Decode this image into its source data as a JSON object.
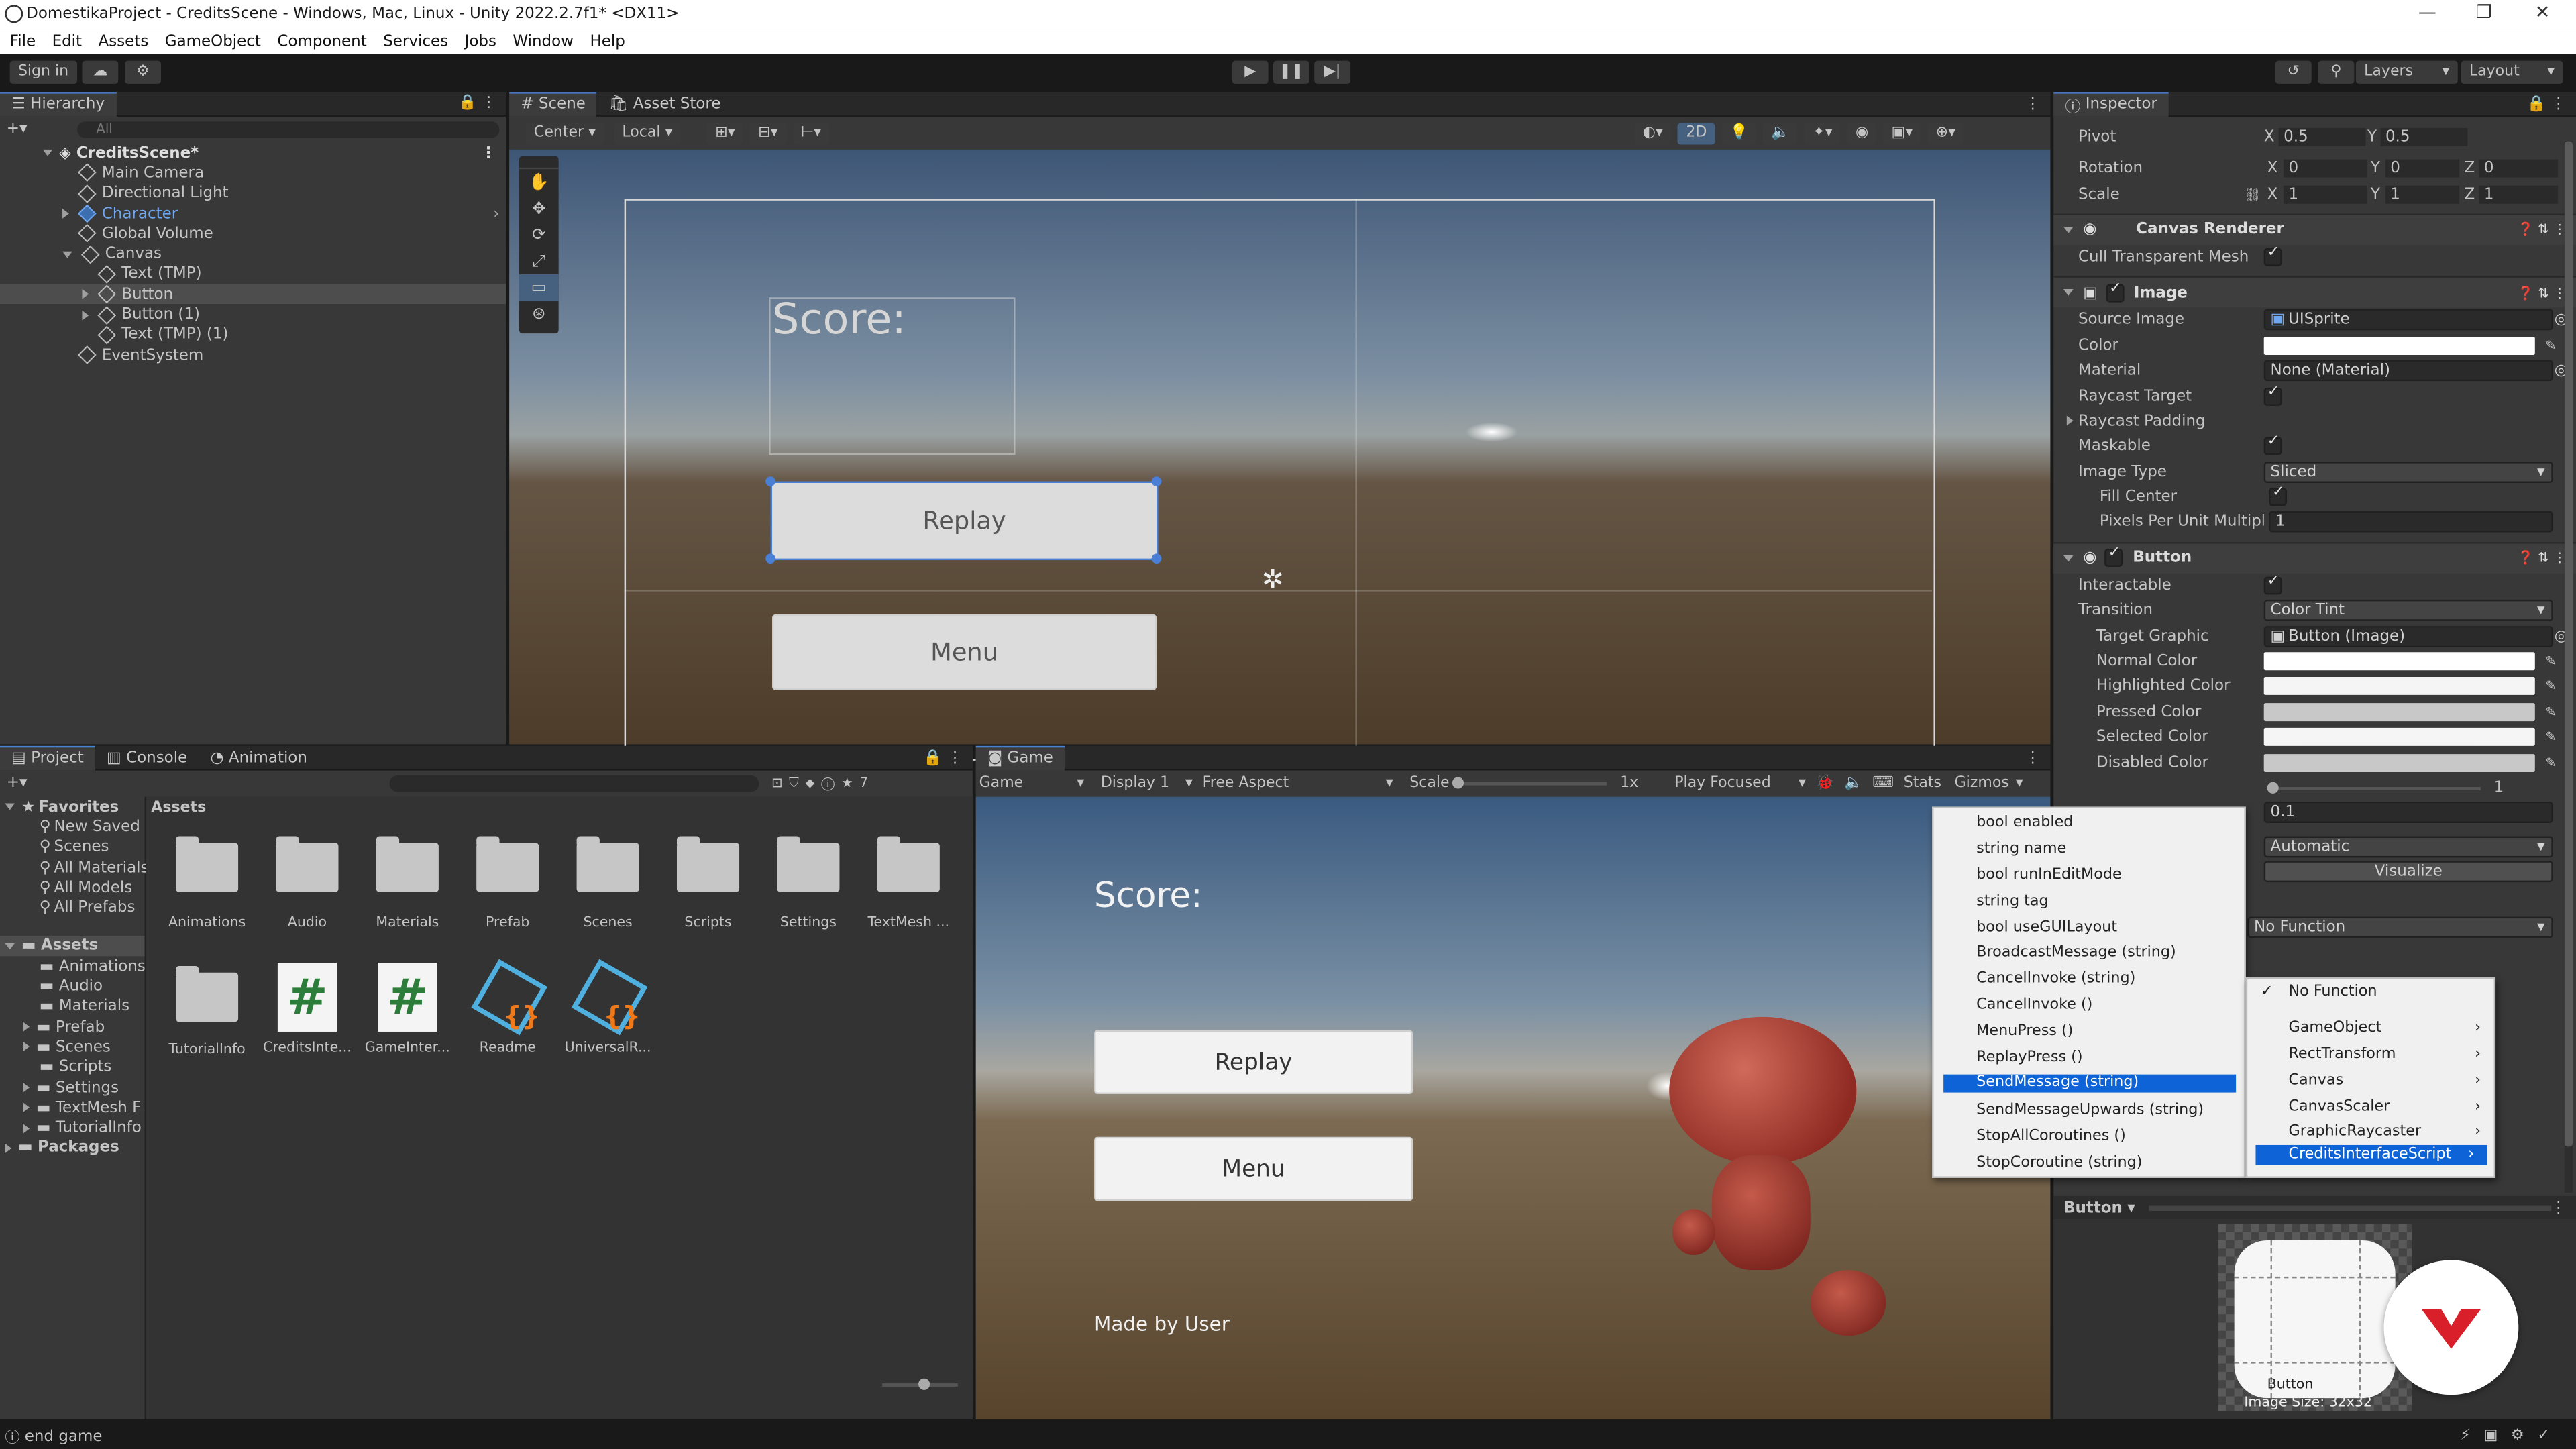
{
  "window": {
    "title": "DomestikaProject - CreditsScene - Windows, Mac, Linux - Unity 2022.2.7f1* <DX11>"
  },
  "menubar": [
    "File",
    "Edit",
    "Assets",
    "GameObject",
    "Component",
    "Services",
    "Jobs",
    "Window",
    "Help"
  ],
  "toolbar": {
    "sign_in": "Sign in",
    "layers": "Layers",
    "layout": "Layout"
  },
  "hierarchy": {
    "tab": "Hierarchy",
    "search_placeholder": "All",
    "items": [
      {
        "label": "CreditsScene*",
        "depth": 0
      },
      {
        "label": "Main Camera",
        "depth": 1
      },
      {
        "label": "Directional Light",
        "depth": 1
      },
      {
        "label": "Character",
        "depth": 1
      },
      {
        "label": "Global Volume",
        "depth": 1
      },
      {
        "label": "Canvas",
        "depth": 1
      },
      {
        "label": "Text (TMP)",
        "depth": 2
      },
      {
        "label": "Button",
        "depth": 2
      },
      {
        "label": "Button (1)",
        "depth": 2
      },
      {
        "label": "Text (TMP) (1)",
        "depth": 2
      },
      {
        "label": "EventSystem",
        "depth": 1
      }
    ]
  },
  "scene": {
    "tabs": [
      "Scene",
      "Asset Store"
    ],
    "pivot": "Center",
    "space": "Local",
    "mode_2d": "2D",
    "score_label": "Score:",
    "replay_label": "Replay",
    "menu_label": "Menu"
  },
  "project": {
    "tabs": [
      "Project",
      "Console",
      "Animation"
    ],
    "hidden_count": "7",
    "favorites_label": "Favorites",
    "favorites": [
      "New Saved",
      "Scenes",
      "All Materials",
      "All Models",
      "All Prefabs"
    ],
    "assets_label": "Assets",
    "assets_tree": [
      "Animations",
      "Audio",
      "Materials",
      "Prefab",
      "Scenes",
      "Scripts",
      "Settings",
      "TextMesh F",
      "TutorialInfo"
    ],
    "packages_label": "Packages",
    "breadcrumb": "Assets",
    "grid": [
      {
        "label": "Animations",
        "kind": "folder"
      },
      {
        "label": "Audio",
        "kind": "folder"
      },
      {
        "label": "Materials",
        "kind": "folder"
      },
      {
        "label": "Prefab",
        "kind": "folder"
      },
      {
        "label": "Scenes",
        "kind": "folder"
      },
      {
        "label": "Scripts",
        "kind": "folder"
      },
      {
        "label": "Settings",
        "kind": "folder"
      },
      {
        "label": "TextMesh ...",
        "kind": "folder"
      },
      {
        "label": "TutorialInfo",
        "kind": "folder"
      },
      {
        "label": "CreditsInte...",
        "kind": "script"
      },
      {
        "label": "GameInter...",
        "kind": "script"
      },
      {
        "label": "Readme",
        "kind": "asset"
      },
      {
        "label": "UniversalR...",
        "kind": "asset"
      }
    ]
  },
  "game": {
    "tab": "Game",
    "view": "Game",
    "display": "Display 1",
    "aspect": "Free Aspect",
    "scale_label": "Scale",
    "scale_value": "1x",
    "play_mode": "Play Focused",
    "stats": "Stats",
    "gizmos": "Gizmos",
    "score_label": "Score:",
    "replay_label": "Replay",
    "menu_label": "Menu",
    "credit": "Made by User"
  },
  "inspector": {
    "tab": "Inspector",
    "pivot": {
      "label": "Pivot",
      "x": "0.5",
      "y": "0.5"
    },
    "rotation": {
      "label": "Rotation",
      "x": "0",
      "y": "0",
      "z": "0"
    },
    "scale": {
      "label": "Scale",
      "x": "1",
      "y": "1",
      "z": "1"
    },
    "canvas_renderer": {
      "title": "Canvas Renderer",
      "cull": "Cull Transparent Mesh"
    },
    "image": {
      "title": "Image",
      "source_image_label": "Source Image",
      "source_image": "UISprite",
      "color_label": "Color",
      "material_label": "Material",
      "material": "None (Material)",
      "raycast_target": "Raycast Target",
      "raycast_padding": "Raycast Padding",
      "maskable": "Maskable",
      "image_type_label": "Image Type",
      "image_type": "Sliced",
      "fill_center": "Fill Center",
      "ppu_label": "Pixels Per Unit Multiplie",
      "ppu": "1"
    },
    "button": {
      "title": "Button",
      "interactable": "Interactable",
      "transition_label": "Transition",
      "transition": "Color Tint",
      "target_graphic_label": "Target Graphic",
      "target_graphic": "Button (Image)",
      "normal": "Normal Color",
      "highlighted": "Highlighted Color",
      "pressed": "Pressed Color",
      "selected": "Selected Color",
      "disabled": "Disabled Color",
      "color_multiplier": "1",
      "fade_duration": "0.1",
      "navigation": "Automatic",
      "visualize": "Visualize",
      "function_field": "No Function"
    },
    "preview_label": "Button",
    "preview_name": "Button",
    "preview_size": "Image Size: 32x32"
  },
  "colors": {
    "accent": "#0e63d6",
    "normal": "#ffffff",
    "highlighted": "#f5f5f5",
    "pressed": "#c8c8c8",
    "selected": "#f5f5f5",
    "disabled": "#c8c8c8"
  },
  "dropdown_methods": [
    "bool enabled",
    "string name",
    "bool runInEditMode",
    "string tag",
    "bool useGUILayout",
    "BroadcastMessage (string)",
    "CancelInvoke (string)",
    "CancelInvoke ()",
    "MenuPress ()",
    "ReplayPress ()",
    "SendMessage (string)",
    "SendMessageUpwards (string)",
    "StopAllCoroutines ()",
    "StopCoroutine (string)"
  ],
  "dropdown_selected": 10,
  "dropdown_components": {
    "no_function": "No Function",
    "items": [
      "GameObject",
      "RectTransform",
      "Canvas",
      "CanvasScaler",
      "GraphicRaycaster",
      "CreditsInterfaceScript"
    ],
    "selected": 5
  },
  "status": {
    "message": "end game"
  }
}
